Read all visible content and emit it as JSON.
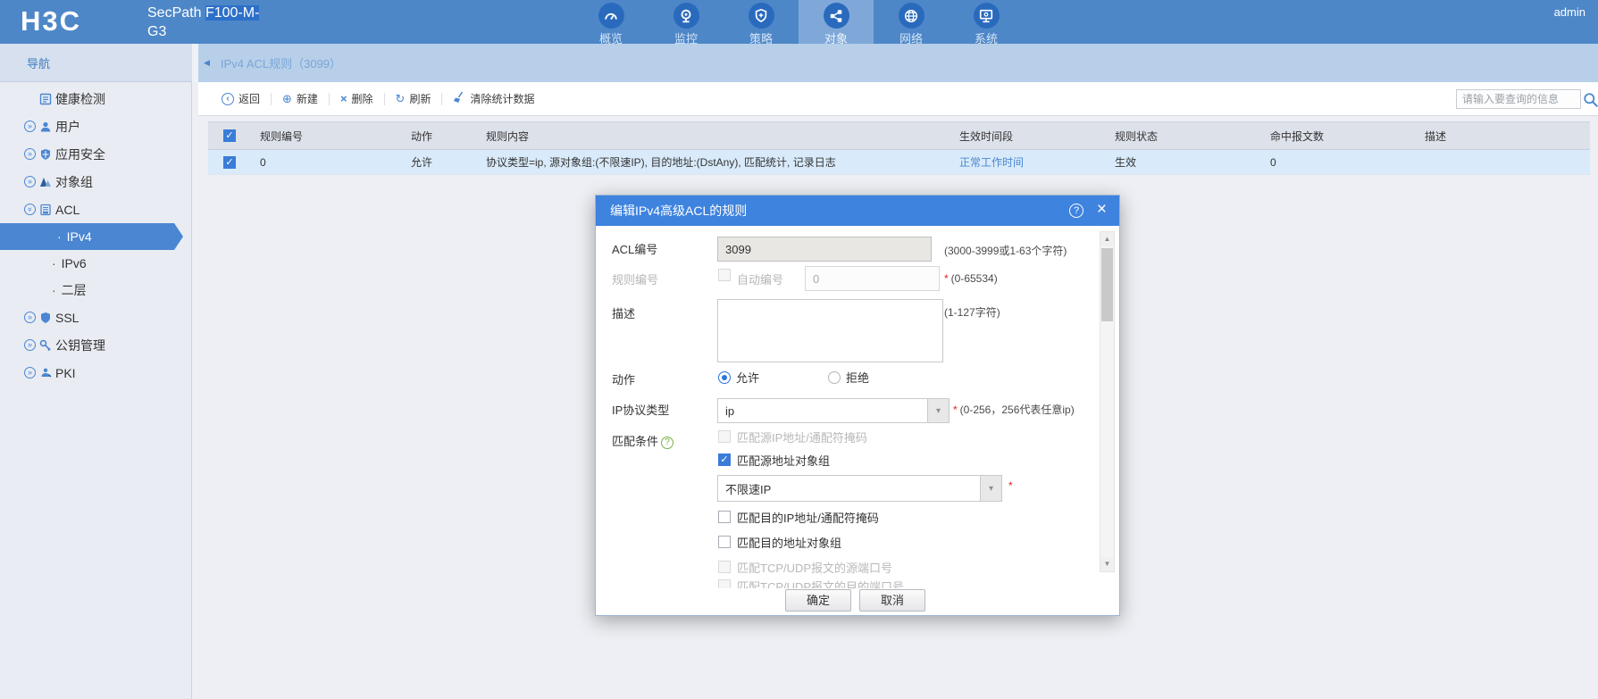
{
  "icons": {
    "back": "‹",
    "new": "⊕",
    "delete": "×",
    "refresh": "↻",
    "dropdown": "▾",
    "check": "✓",
    "chevron": "»",
    "help": "?",
    "close": "×",
    "scroll_up": "▲",
    "scroll_down": "▼",
    "collapse": "◀",
    "bullet": "·",
    "required": "*"
  },
  "header": {
    "logo": "H3C",
    "product_line1_prefix": "SecPath ",
    "product_line1_selected": "F100-M-",
    "product_line2": "G3",
    "user": "admin",
    "nav": [
      {
        "label": "概览"
      },
      {
        "label": "监控"
      },
      {
        "label": "策略"
      },
      {
        "label": "对象"
      },
      {
        "label": "网络"
      },
      {
        "label": "系统"
      }
    ]
  },
  "sidebar": {
    "title": "导航",
    "items": [
      {
        "label": "健康检测"
      },
      {
        "label": "用户"
      },
      {
        "label": "应用安全"
      },
      {
        "label": "对象组"
      },
      {
        "label": "ACL"
      },
      {
        "label": "IPv4"
      },
      {
        "label": "IPv6"
      },
      {
        "label": "二层"
      },
      {
        "label": "SSL"
      },
      {
        "label": "公钥管理"
      },
      {
        "label": "PKI"
      }
    ]
  },
  "breadcrumb": "IPv4 ACL规则（3099）",
  "toolbar": {
    "back": "返回",
    "new": "新建",
    "delete": "删除",
    "refresh": "刷新",
    "clear": "清除统计数据",
    "search_placeholder": "请输入要查询的信息"
  },
  "table": {
    "columns": [
      "规则编号",
      "动作",
      "规则内容",
      "生效时间段",
      "规则状态",
      "命中报文数",
      "描述"
    ],
    "rows": [
      {
        "rule_id": "0",
        "action": "允许",
        "content": "协议类型=ip, 源对象组:(不限速IP), 目的地址:(DstAny), 匹配统计, 记录日志",
        "time_range": "正常工作时间",
        "status": "生效",
        "hits": "0",
        "description": ""
      }
    ]
  },
  "dialog": {
    "title": "编辑IPv4高级ACL的规则",
    "acl_number": {
      "label": "ACL编号",
      "value": "3099",
      "hint": "(3000-3999或1-63个字符)"
    },
    "rule_number": {
      "label": "规则编号",
      "auto": "自动编号",
      "value": "0",
      "hint": "(0-65534)"
    },
    "description": {
      "label": "描述",
      "hint": "(1-127字符)"
    },
    "action": {
      "label": "动作",
      "allow": "允许",
      "deny": "拒绝"
    },
    "protocol": {
      "label": "IP协议类型",
      "value": "ip",
      "hint": "(0-256，256代表任意ip)"
    },
    "match": {
      "label": "匹配条件",
      "src_ip": "匹配源IP地址/通配符掩码",
      "src_group": "匹配源地址对象组",
      "src_group_value": "不限速IP",
      "dst_ip": "匹配目的IP地址/通配符掩码",
      "dst_group": "匹配目的地址对象组",
      "tcp_src_port": "匹配TCP/UDP报文的源端口号",
      "tcp_dst_port": "匹配TCP/UDP报文的目的端口号"
    },
    "ok": "确定",
    "cancel": "取消"
  }
}
